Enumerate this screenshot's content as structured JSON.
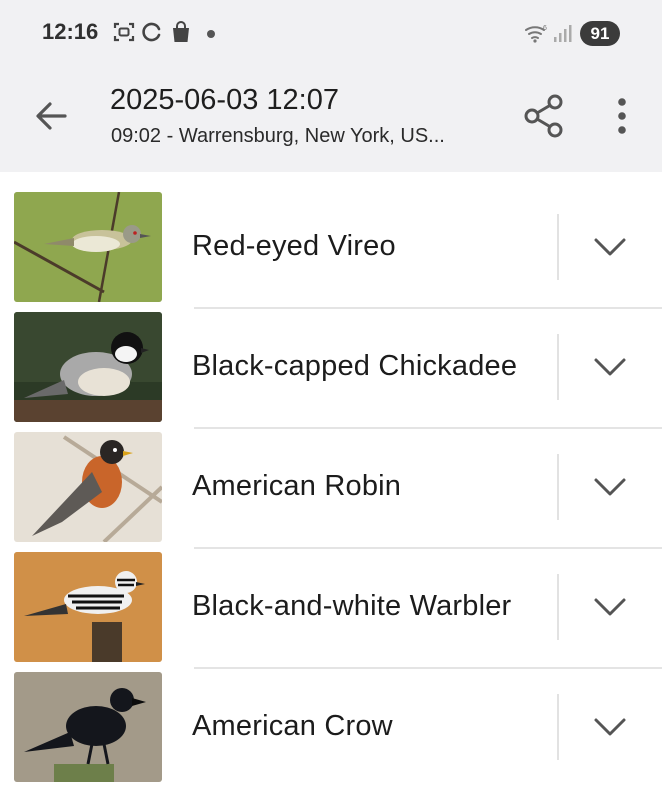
{
  "status_bar": {
    "time": "12:16",
    "battery": "91",
    "icons": [
      "screenshot-icon",
      "sync-icon",
      "shopping-bag-icon",
      "notification-dot",
      "wifi-icon",
      "signal-icon"
    ]
  },
  "app_bar": {
    "title": "2025-06-03 12:07",
    "subtitle": "09:02 - Warrensburg, New York, US...",
    "icons": [
      "back-arrow-icon",
      "share-icon",
      "more-vert-icon"
    ]
  },
  "species": [
    {
      "name": "Red-eyed Vireo"
    },
    {
      "name": "Black-capped Chickadee"
    },
    {
      "name": "American Robin"
    },
    {
      "name": "Black-and-white Warbler"
    },
    {
      "name": "American Crow"
    }
  ],
  "colors": {
    "app_bar_background": "#f1f1f3",
    "divider": "#e4e4e4",
    "icon": "#555555"
  }
}
